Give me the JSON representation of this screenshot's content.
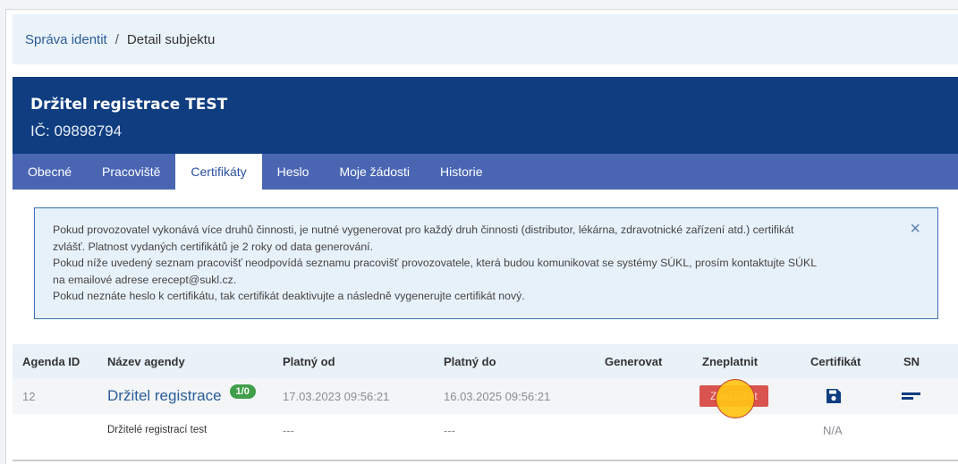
{
  "breadcrumb": {
    "root": "Správa identit",
    "separator": "/",
    "current": "Detail subjektu"
  },
  "header": {
    "title": "Držitel registrace TEST",
    "ico": "IČ: 09898794"
  },
  "tabs": [
    {
      "label": "Obecné",
      "active": false
    },
    {
      "label": "Pracoviště",
      "active": false
    },
    {
      "label": "Certifikáty",
      "active": true
    },
    {
      "label": "Heslo",
      "active": false
    },
    {
      "label": "Moje žádosti",
      "active": false
    },
    {
      "label": "Historie",
      "active": false
    }
  ],
  "notice": {
    "lines": [
      "Pokud provozovatel vykonává více druhů činnosti, je nutné vygenerovat pro každý druh činnosti (distributor, lékárna, zdravotnické zařízení atd.) certifikát",
      "zvlášť. Platnost vydaných certifikátů je 2 roky od data generování.",
      "Pokud níže uvedený seznam pracovišť neodpovídá seznamu pracovišť provozovatele, která budou komunikovat se systémy SÚKL, prosím kontaktujte SÚKL",
      "na emailové adrese erecept@sukl.cz.",
      "Pokud neznáte heslo k certifikátu, tak certifikát deaktivujte a následně vygenerujte certifikát nový."
    ],
    "close": "×"
  },
  "table": {
    "headers": {
      "agenda_id": "Agenda ID",
      "name": "Název agendy",
      "valid_from": "Platný od",
      "valid_to": "Platný do",
      "generate": "Generovat",
      "revoke": "Zneplatnit",
      "certificate": "Certifikát",
      "sn": "SN"
    },
    "row": {
      "agenda_id": "12",
      "name": "Držitel registrace",
      "badge": "1/0",
      "valid_from": "17.03.2023 09:56:21",
      "valid_to": "16.03.2025 09:56:21",
      "revoke_label": "Zneplatnit",
      "certificate_icon": "floppy-disk-icon",
      "sn_icon": "serial-lines-icon"
    },
    "subrow": {
      "name": "Držitelé registrací test",
      "valid_from": "---",
      "valid_to": "---",
      "certificate": "N/A"
    }
  },
  "colors": {
    "header_bg": "#0f3d80",
    "tabs_bg": "#4a66b3",
    "link": "#2b5d99",
    "badge": "#3f9f4a",
    "revoke": "#d9534f",
    "click_marker": "#ffc414"
  }
}
